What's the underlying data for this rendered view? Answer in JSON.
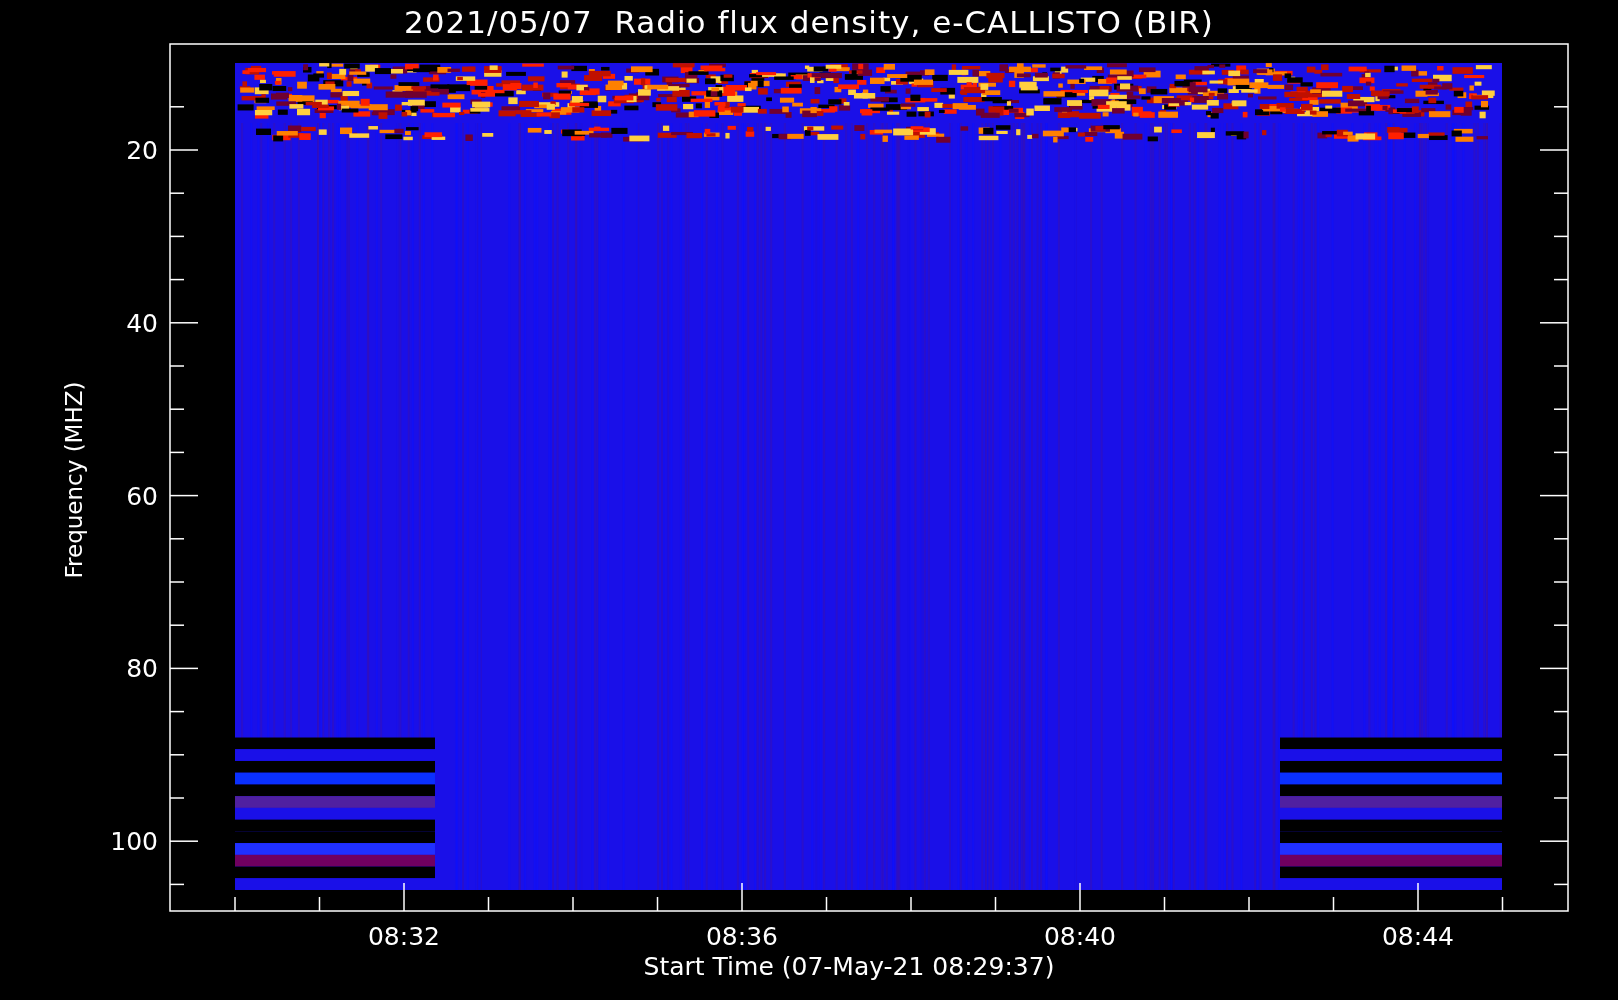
{
  "title": "2021/05/07  Radio flux density, e-CALLISTO (BIR)",
  "plot": {
    "ylabel": "Frequency (MHZ)",
    "xlabel": "Start Time (07-May-21 08:29:37)",
    "y_tick_labels": [
      "20",
      "40",
      "60",
      "80",
      "100"
    ],
    "x_tick_labels": [
      "08:32",
      "08:36",
      "08:40",
      "08:44"
    ]
  }
}
